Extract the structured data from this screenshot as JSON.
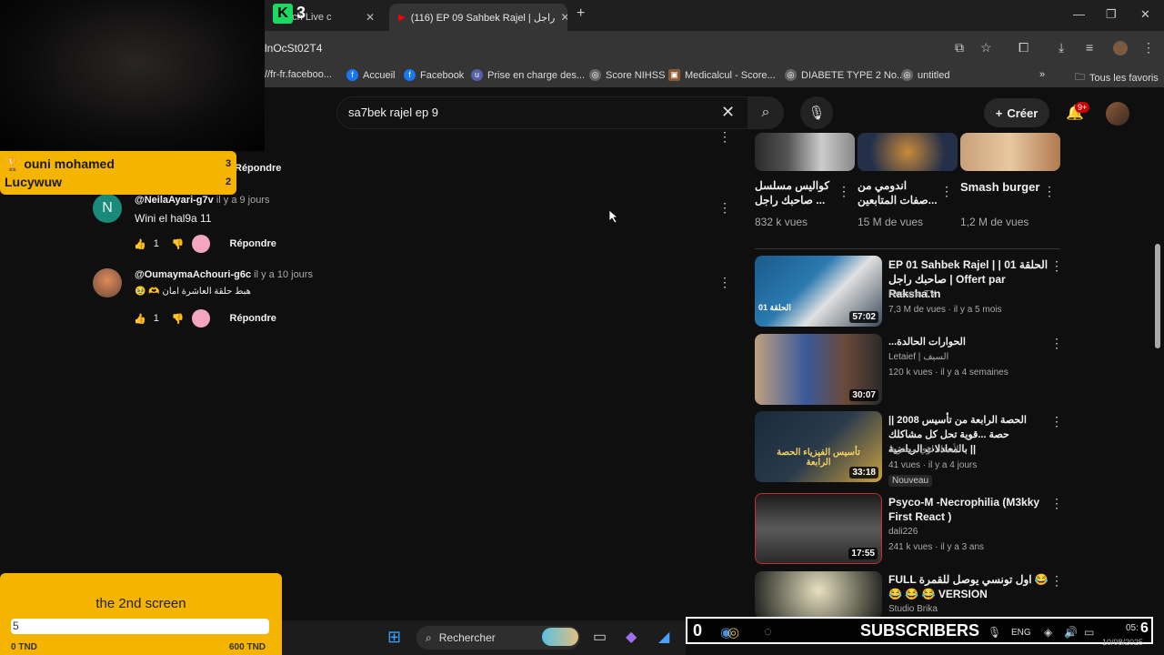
{
  "browser": {
    "tabs": [
      {
        "label": "Watch Live c"
      },
      {
        "label": "(116) EP 09 Sahbek Rajel | راجل"
      }
    ],
    "address": "lnOcSt02T4",
    "bookmarks": [
      "//fr-fr.faceboo...",
      "Accueil",
      "Facebook",
      "Prise en charge des...",
      "Score NIHSS",
      "Medicalcul - Score...",
      "DIABETE TYPE 2 No...",
      "untitled"
    ],
    "all_bookmarks": "Tous les favoris"
  },
  "youtube": {
    "search_query": "sa7bek rajel ep 9",
    "create_label": "Créer",
    "notif_badge": "9+",
    "comments": [
      {
        "reply_label": "Répondre"
      },
      {
        "avatar_letter": "N",
        "handle": "@NeilaAyari-g7v",
        "age": "il y a 9 jours",
        "text": "Wini el hal9a 11",
        "likes": "1",
        "reply_label": "Répondre"
      },
      {
        "handle": "@OumaymaAchouri-g6c",
        "age": "il y a 10 jours",
        "text": "🥹 🫶 هبط حلقة العاشرة امان",
        "likes": "1",
        "reply_label": "Répondre"
      }
    ],
    "shorts": [
      {
        "title": "كواليس مسلسل صاحبك راجل ...",
        "views": "832 k vues"
      },
      {
        "title": "اندومي من ...صفات المتابعين",
        "views": "15 M de vues"
      },
      {
        "title": "Smash burger",
        "views": "1,2 M de vues"
      }
    ],
    "videos": [
      {
        "title": "EP 01 Sahbek Rajel | | 01 الحلقة صاحبك راجل | Offert par Raksha.tn",
        "channel": "Nessma TV",
        "meta": "7,3 M de vues · il y a 5 mois",
        "duration": "57:02",
        "thumb_label": "الحلقة 01"
      },
      {
        "title": "...الحوارات الحالدة",
        "channel": "Letaief | السيف",
        "meta": "120 k vues · il y a 4 semaines",
        "duration": "30:07"
      },
      {
        "title": "الحصة الرابعة من تأسيس 2008 || حصة ...قوية تحل كل مشاكلك بالمعادلات الرياضية ||",
        "channel": "الأستاذ لؤي محفوظ",
        "meta": "41 vues · il y a 4 jours",
        "badge": "Nouveau",
        "duration": "33:18",
        "thumb_label": "تأسيس الفيزياء الحصة الرابعة"
      },
      {
        "title": "Psyco-M -Necrophilia (M3kky First React )",
        "channel": "dali226",
        "meta": "241 k vues · il y a 3 ans",
        "duration": "17:55"
      },
      {
        "title": "FULL اول تونسي يوصل للقمرة 😂 😂 😂 😂 VERSION",
        "channel": "Studio Brika",
        "meta": ""
      }
    ]
  },
  "overlay": {
    "leaderboard": [
      {
        "name": "ouni mohamed",
        "count": "3"
      },
      {
        "name": "Lucywuw",
        "count": "2"
      }
    ],
    "logo_text": "3",
    "goal_title": "the 2nd screen",
    "goal_value": "5",
    "goal_min": "0 TND",
    "goal_max": "600 TND",
    "goal_progress": 0.0,
    "subs_count": "0",
    "subs_label": "SUBSCRIBERS"
  },
  "taskbar": {
    "search_label": "Rechercher",
    "lang": "ENG",
    "time": "05:",
    "time_digit": "6",
    "date": "10/08/2025"
  },
  "colors": {
    "overlay_yellow": "#f4b400",
    "yt_bg": "#0f0f0f",
    "notif_red": "#cc0000"
  }
}
